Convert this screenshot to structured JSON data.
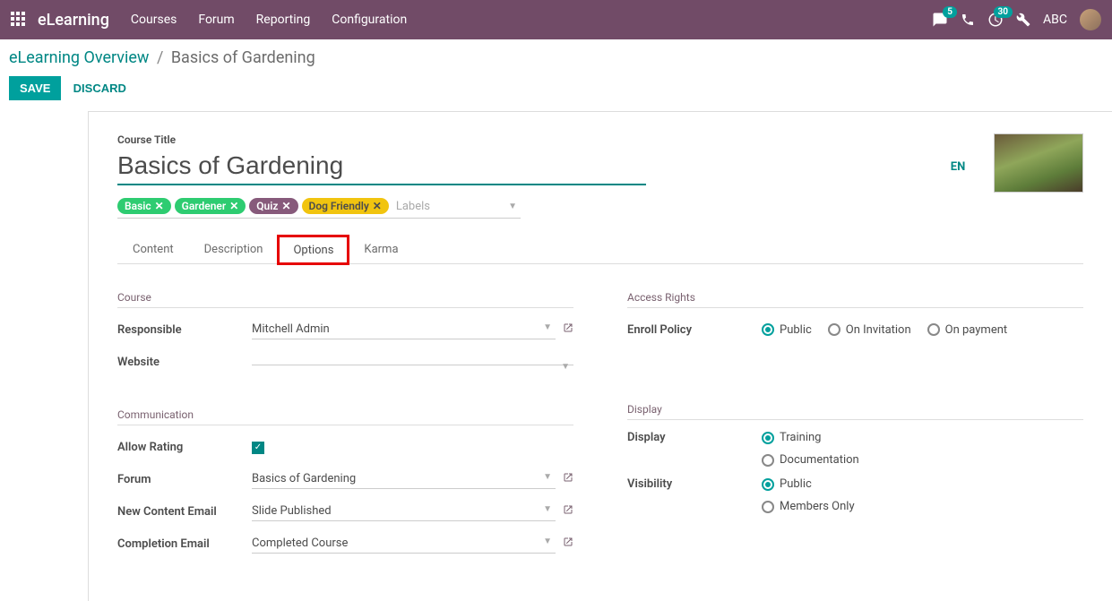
{
  "navbar": {
    "brand": "eLearning",
    "menu": [
      "Courses",
      "Forum",
      "Reporting",
      "Configuration"
    ],
    "chat_badge": "5",
    "activity_badge": "30",
    "user": "ABC"
  },
  "breadcrumb": {
    "root": "eLearning Overview",
    "current": "Basics of Gardening"
  },
  "buttons": {
    "save": "SAVE",
    "discard": "DISCARD"
  },
  "title": {
    "label": "Course Title",
    "value": "Basics of Gardening",
    "lang": "EN"
  },
  "tags": {
    "items": [
      {
        "label": "Basic",
        "color": "tag-green"
      },
      {
        "label": "Gardener",
        "color": "tag-green"
      },
      {
        "label": "Quiz",
        "color": "tag-purple"
      },
      {
        "label": "Dog Friendly",
        "color": "tag-yellow"
      }
    ],
    "placeholder": "Labels"
  },
  "tabs": [
    "Content",
    "Description",
    "Options",
    "Karma"
  ],
  "active_tab": "Options",
  "sections": {
    "course": {
      "title": "Course",
      "responsible_label": "Responsible",
      "responsible_value": "Mitchell Admin",
      "website_label": "Website",
      "website_value": ""
    },
    "communication": {
      "title": "Communication",
      "allow_rating_label": "Allow Rating",
      "forum_label": "Forum",
      "forum_value": "Basics of Gardening",
      "new_content_label": "New Content Email",
      "new_content_value": "Slide Published",
      "completion_label": "Completion Email",
      "completion_value": "Completed Course"
    },
    "access": {
      "title": "Access Rights",
      "enroll_label": "Enroll Policy",
      "enroll_options": [
        "Public",
        "On Invitation",
        "On payment"
      ],
      "enroll_selected": "Public"
    },
    "display": {
      "title": "Display",
      "display_label": "Display",
      "display_options": [
        "Training",
        "Documentation"
      ],
      "display_selected": "Training",
      "visibility_label": "Visibility",
      "visibility_options": [
        "Public",
        "Members Only"
      ],
      "visibility_selected": "Public"
    }
  }
}
